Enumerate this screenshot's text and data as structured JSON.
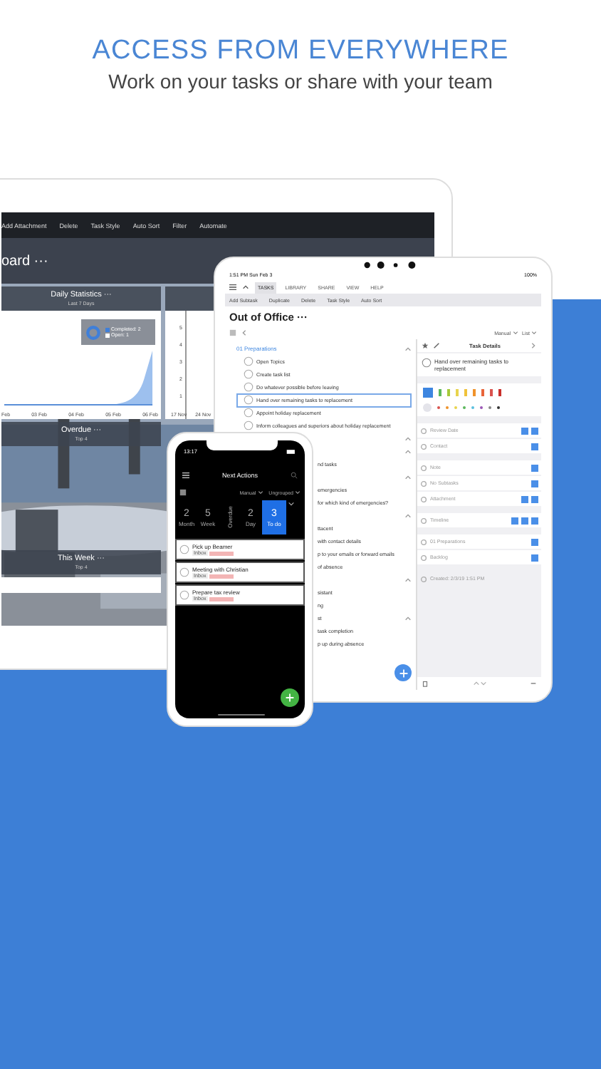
{
  "header": {
    "title": "ACCESS FROM EVERYWHERE",
    "subtitle": "Work on your tasks or share with your team"
  },
  "laptop": {
    "toolbar": [
      "Add Attachment",
      "Delete",
      "Task Style",
      "Auto Sort",
      "Filter",
      "Automate"
    ],
    "title": "oard ···",
    "stats": {
      "title": "Daily Statistics ···",
      "subtitle": "Last 7 Days",
      "legend": [
        {
          "label": "Completed: 2",
          "color": "#3f7fd9"
        },
        {
          "label": "Open: 1",
          "color": "#ffffff"
        }
      ],
      "x_labels": [
        "Feb",
        "03 Feb",
        "04 Feb",
        "05 Feb",
        "06 Feb"
      ]
    },
    "side_chart": {
      "y_labels": [
        "5",
        "4",
        "3",
        "2",
        "1"
      ],
      "x_labels": [
        "17 Nov",
        "24 Nov"
      ]
    },
    "sections": [
      {
        "title": "Overdue ···",
        "subtitle": "Top 4"
      },
      {
        "title": "This Week ···",
        "subtitle": "Top 4"
      }
    ]
  },
  "tablet": {
    "status_time": "1:51 PM  Sun Feb 3",
    "battery": "100%",
    "tabs": [
      {
        "label": "TASKS",
        "selected": true
      },
      {
        "label": "LIBRARY",
        "selected": false
      },
      {
        "label": "SHARE",
        "selected": false
      },
      {
        "label": "VIEW",
        "selected": false
      },
      {
        "label": "HELP",
        "selected": false
      }
    ],
    "toolbar": [
      "Add Subtask",
      "Duplicate",
      "Delete",
      "Task Style",
      "Auto Sort"
    ],
    "title": "Out of Office ···",
    "sort": "Manual",
    "view": "List",
    "rows": [
      {
        "kind": "group",
        "text": "01 Preparations"
      },
      {
        "kind": "task",
        "text": "Open Topics",
        "selected": false
      },
      {
        "kind": "task",
        "text": "Create task list",
        "selected": false
      },
      {
        "kind": "task",
        "text": "Do whatever possible before leaving",
        "selected": false
      },
      {
        "kind": "task",
        "text": "Hand over remaining tasks to replacement",
        "selected": true
      },
      {
        "kind": "task",
        "text": "Appoint holiday replacement",
        "selected": false
      },
      {
        "kind": "task",
        "text": "Inform colleagues and superiors about holiday replacement",
        "selected": false
      },
      {
        "kind": "group"
      },
      {
        "kind": "group"
      },
      {
        "kind": "cut",
        "text": "nd tasks"
      },
      {
        "kind": "group"
      },
      {
        "kind": "cut",
        "text": "emergencies"
      },
      {
        "kind": "cut",
        "text": "for which kind of emergencies?"
      },
      {
        "kind": "group"
      },
      {
        "kind": "cut",
        "text": "ttacent"
      },
      {
        "kind": "cut",
        "text": "with contact details"
      },
      {
        "kind": "cut",
        "text": "p to your emails or forward emails"
      },
      {
        "kind": "cut",
        "text": "of absence"
      },
      {
        "kind": "group"
      },
      {
        "kind": "cut",
        "text": "sistant"
      },
      {
        "kind": "cut",
        "text": "ng"
      },
      {
        "kind": "cut-group",
        "text": "st"
      },
      {
        "kind": "cut",
        "text": "task completion"
      },
      {
        "kind": "cut",
        "text": "p up during absence"
      }
    ],
    "details": {
      "title": "Task Details",
      "task": "Hand over remaining tasks to replacement",
      "flags": [
        {
          "color": "#3d86e0",
          "selected": true
        },
        {
          "color": "#5cb85c",
          "selected": false
        },
        {
          "color": "#a6c93a",
          "selected": false
        },
        {
          "color": "#e8d44d",
          "selected": false
        },
        {
          "color": "#f0c23a",
          "selected": false
        },
        {
          "color": "#f0932b",
          "selected": false
        },
        {
          "color": "#e8643a",
          "selected": false
        },
        {
          "color": "#d9534f",
          "selected": false
        },
        {
          "color": "#c9302c",
          "selected": false
        }
      ],
      "dots": [
        {
          "color": "#e4e4ea",
          "selected": true
        },
        {
          "color": "#d9534f",
          "selected": false
        },
        {
          "color": "#f0932b",
          "selected": false
        },
        {
          "color": "#e8d44d",
          "selected": false
        },
        {
          "color": "#5cb85c",
          "selected": false
        },
        {
          "color": "#5bc0de",
          "selected": false
        },
        {
          "color": "#9b59b6",
          "selected": false
        },
        {
          "color": "#888888",
          "selected": false
        },
        {
          "color": "#333333",
          "selected": false
        }
      ],
      "groups": [
        {
          "fields": [
            {
              "kind": "date",
              "label": "Review Date"
            },
            {
              "kind": "contact",
              "label": "Contact"
            }
          ]
        },
        {
          "fields": [
            {
              "kind": "note",
              "label": "Note"
            },
            {
              "kind": "subtasks",
              "label": "No Subtasks"
            },
            {
              "kind": "attachment",
              "label": "Attachment"
            }
          ]
        },
        {
          "fields": [
            {
              "kind": "timeline",
              "label": "Timeline"
            }
          ]
        },
        {
          "fields": [
            {
              "kind": "project",
              "label": "01 Preparations"
            },
            {
              "kind": "status",
              "label": "Backlog"
            }
          ]
        },
        {
          "fields": [
            {
              "kind": "created",
              "label": "Created: 2/3/19 1:51 PM"
            }
          ]
        }
      ]
    }
  },
  "phone": {
    "time": "13:17",
    "title": "Next Actions",
    "sort": "Manual",
    "grouping": "Ungrouped",
    "filters": [
      {
        "kind": "count",
        "count": "2",
        "label": "Month",
        "selected": false
      },
      {
        "kind": "count",
        "count": "5",
        "label": "Week",
        "selected": false
      },
      {
        "kind": "vertical",
        "label": "Overdue",
        "selected": false
      },
      {
        "kind": "count",
        "count": "2",
        "label": "Day",
        "selected": false
      },
      {
        "kind": "count",
        "count": "3",
        "label": "To do",
        "selected": true
      }
    ],
    "tasks": [
      {
        "text": "Pick up Beamer",
        "tag": "Inbox"
      },
      {
        "text": "Meeting with Christian",
        "tag": "Inbox"
      },
      {
        "text": "Prepare tax review",
        "tag": "Inbox"
      }
    ]
  }
}
